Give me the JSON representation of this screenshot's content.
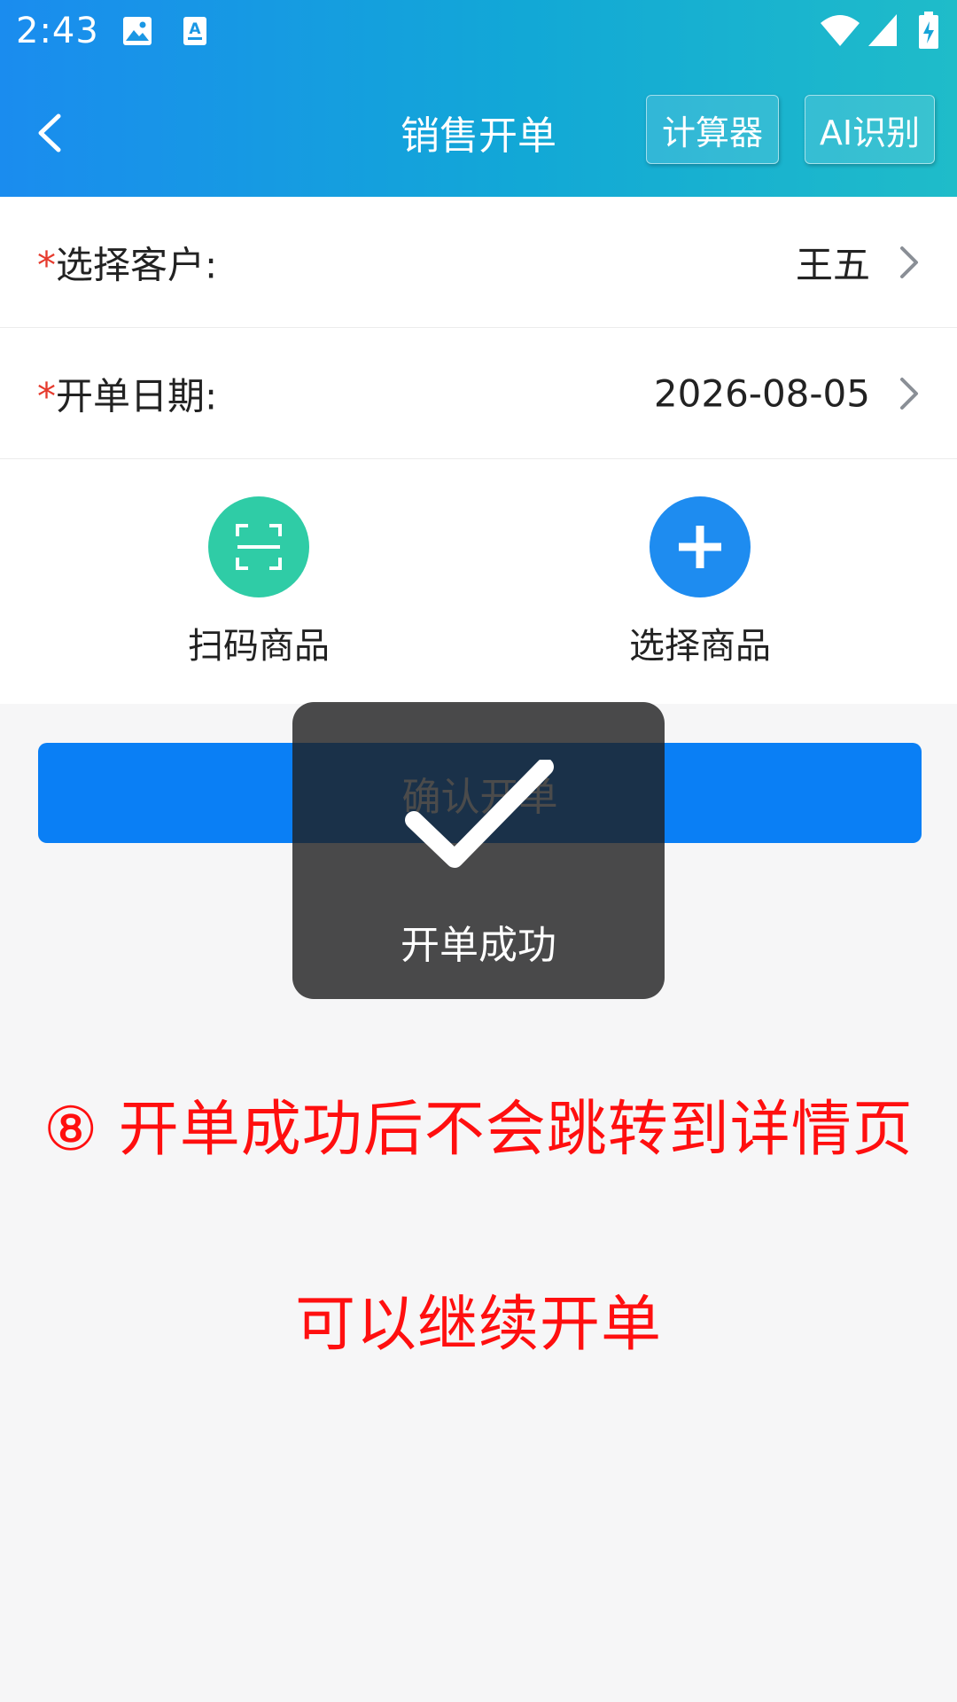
{
  "status_bar": {
    "time": "2:43",
    "icons": [
      "image-icon",
      "a-text-icon",
      "wifi-icon",
      "signal-icon",
      "battery-icon"
    ]
  },
  "nav": {
    "back_icon": "chevron-left-icon",
    "title": "销售开单",
    "calculator_label": "计算器",
    "ai_label": "AI识别"
  },
  "form": {
    "required_mark": "*",
    "customer": {
      "label": "选择客户:",
      "value": "王五"
    },
    "date": {
      "label": "开单日期:",
      "value": "2026-08-05"
    }
  },
  "actions": {
    "scan": {
      "label": "扫码商品",
      "icon": "scan-icon",
      "color": "#2fcca6"
    },
    "select": {
      "label": "选择商品",
      "icon": "plus-icon",
      "color": "#1e8cf0"
    }
  },
  "confirm_button": {
    "label": "确认开单",
    "color": "#0a7ff5"
  },
  "toast": {
    "icon": "checkmark-icon",
    "text": "开单成功"
  },
  "annotation": {
    "line1": "⑧ 开单成功后不会跳转到详情页",
    "line2": "可以继续开单",
    "color": "#ff0f0f"
  }
}
